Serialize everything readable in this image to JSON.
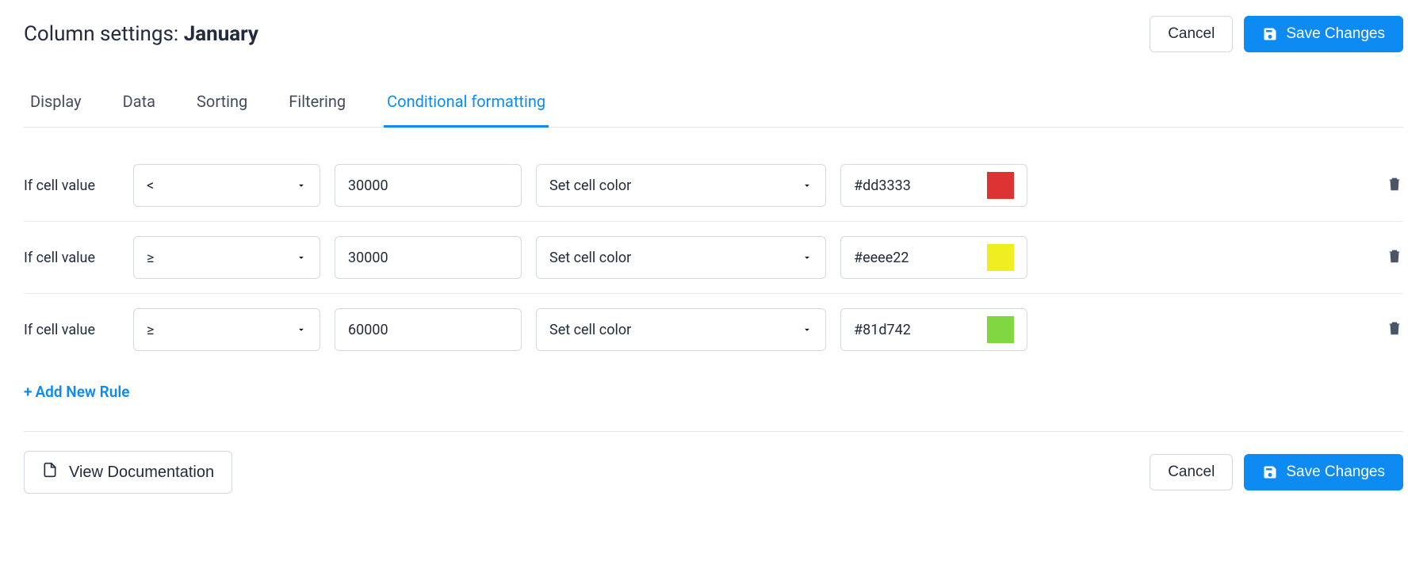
{
  "header": {
    "title_prefix": "Column settings: ",
    "column_name": "January",
    "cancel_label": "Cancel",
    "save_label": "Save Changes"
  },
  "tabs": [
    {
      "label": "Display",
      "active": false
    },
    {
      "label": "Data",
      "active": false
    },
    {
      "label": "Sorting",
      "active": false
    },
    {
      "label": "Filtering",
      "active": false
    },
    {
      "label": "Conditional formatting",
      "active": true
    }
  ],
  "rule_label": "If cell value",
  "rules": [
    {
      "operator": "<",
      "value": "30000",
      "action": "Set cell color",
      "color_hex": "#dd3333"
    },
    {
      "operator": "≥",
      "value": "30000",
      "action": "Set cell color",
      "color_hex": "#eeee22"
    },
    {
      "operator": "≥",
      "value": "60000",
      "action": "Set cell color",
      "color_hex": "#81d742"
    }
  ],
  "add_rule_label": "Add New Rule",
  "footer": {
    "doc_label": "View Documentation",
    "cancel_label": "Cancel",
    "save_label": "Save Changes"
  }
}
